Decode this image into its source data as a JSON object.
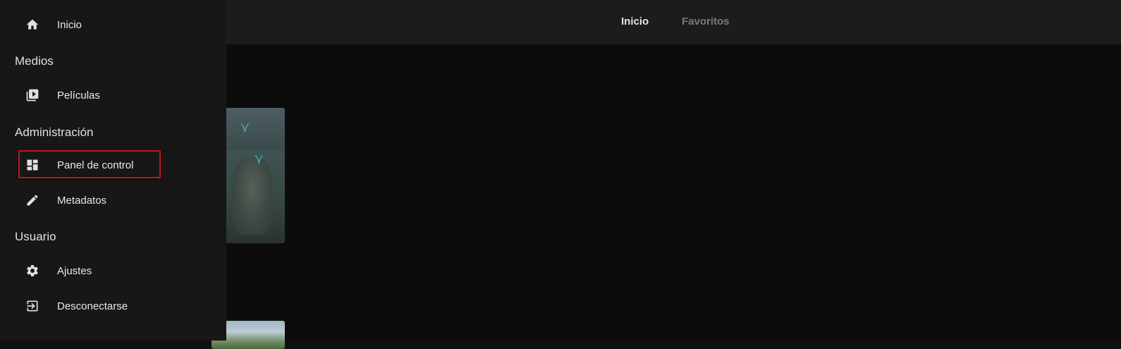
{
  "header": {
    "tabs": [
      {
        "label": "Inicio",
        "active": true
      },
      {
        "label": "Favoritos",
        "active": false
      }
    ]
  },
  "sidebar": {
    "home": {
      "label": "Inicio",
      "icon": "home-icon"
    },
    "sections": [
      {
        "title": "Medios"
      },
      {
        "title": "Administración"
      },
      {
        "title": "Usuario"
      }
    ],
    "items": [
      {
        "label": "Películas",
        "icon": "video-library-icon"
      },
      {
        "label": "Panel de control",
        "icon": "dashboard-icon",
        "highlighted": true
      },
      {
        "label": "Metadatos",
        "icon": "pencil-icon"
      },
      {
        "label": "Ajustes",
        "icon": "gear-icon"
      },
      {
        "label": "Desconectarse",
        "icon": "logout-icon"
      }
    ]
  },
  "colors": {
    "sidebar_bg": "#171717",
    "header_bg": "#1c1c1c",
    "content_bg": "#0c0c0c",
    "highlight": "#c0161b"
  }
}
